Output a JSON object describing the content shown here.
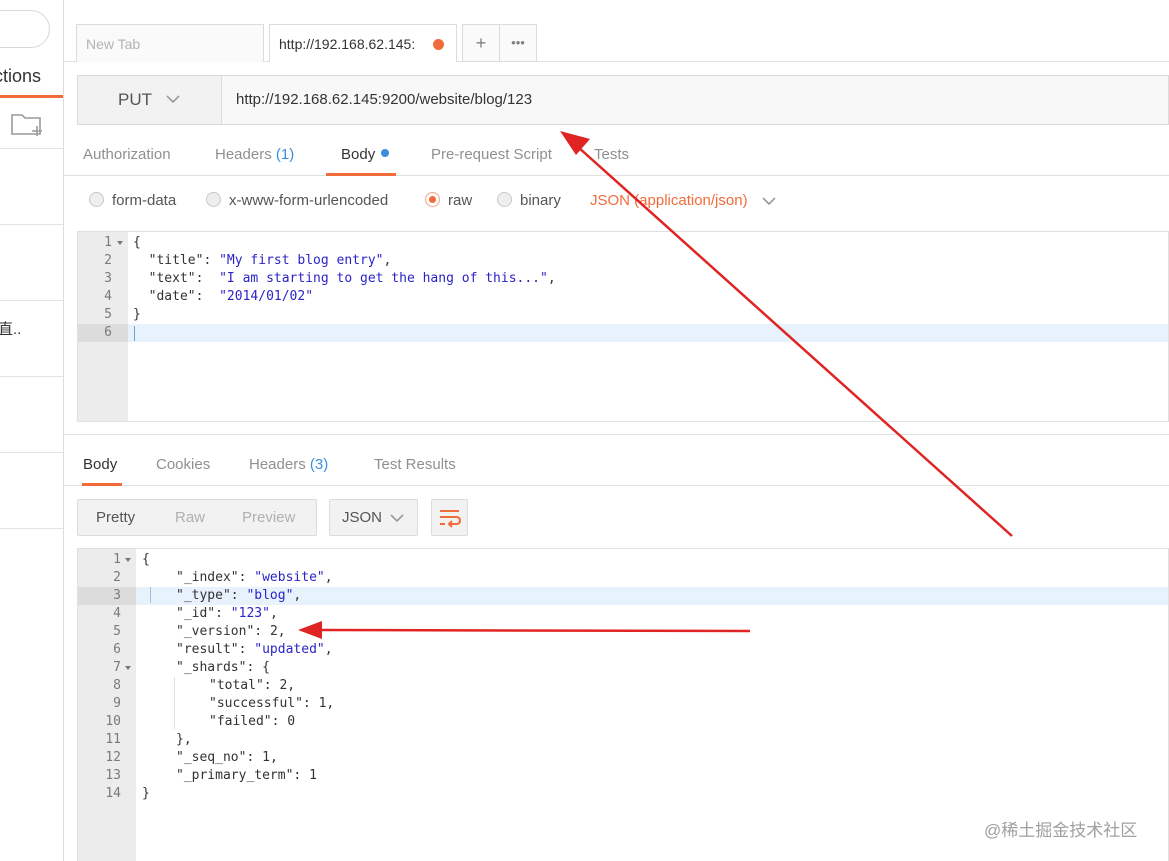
{
  "sidebar": {
    "title": "ctions",
    "item_text": "直.."
  },
  "tabs": {
    "new_tab_label": "New Tab",
    "active_tab_label": "http://192.168.62.145:",
    "add_label": "+",
    "more_label": "•••"
  },
  "request": {
    "method": "PUT",
    "url": "http://192.168.62.145:9200/website/blog/123",
    "tabs": {
      "authorization": "Authorization",
      "headers": "Headers",
      "headers_count": "(1)",
      "body": "Body",
      "pre_request": "Pre-request Script",
      "tests": "Tests"
    },
    "body_types": {
      "form_data": "form-data",
      "urlencoded": "x-www-form-urlencoded",
      "raw": "raw",
      "binary": "binary",
      "content_type": "JSON (application/json)"
    },
    "body_lines": [
      "1",
      "2",
      "3",
      "4",
      "5",
      "6"
    ],
    "body_code": {
      "l1": "{",
      "l2_key": "  \"title\"",
      "l2_val": "\"My first blog entry\"",
      "l3_key": "  \"text\"",
      "l3_val": "\"I am starting to get the hang of this...\"",
      "l4_key": "  \"date\"",
      "l4_val": "\"2014/01/02\"",
      "l5": "}"
    }
  },
  "response": {
    "tabs": {
      "body": "Body",
      "cookies": "Cookies",
      "headers": "Headers",
      "headers_count": "(3)",
      "test_results": "Test Results"
    },
    "views": {
      "pretty": "Pretty",
      "raw": "Raw",
      "preview": "Preview"
    },
    "format": "JSON",
    "lines": [
      "1",
      "2",
      "3",
      "4",
      "5",
      "6",
      "7",
      "8",
      "9",
      "10",
      "11",
      "12",
      "13",
      "14"
    ],
    "code": {
      "open": "{",
      "index_key": "\"_index\"",
      "index_val": "\"website\"",
      "type_key": "\"_type\"",
      "type_val": "\"blog\"",
      "id_key": "\"_id\"",
      "id_val": "\"123\"",
      "version_key": "\"_version\"",
      "version_val": "2",
      "result_key": "\"result\"",
      "result_val": "\"updated\"",
      "shards_key": "\"_shards\"",
      "total_key": "\"total\"",
      "total_val": "2",
      "successful_key": "\"successful\"",
      "successful_val": "1",
      "failed_key": "\"failed\"",
      "failed_val": "0",
      "shards_close": "},",
      "seq_key": "\"_seq_no\"",
      "seq_val": "1",
      "term_key": "\"_primary_term\"",
      "term_val": "1",
      "close": "}"
    }
  },
  "watermark": "@稀土掘金技术社区",
  "colors": {
    "accent": "#f26b3a",
    "link_blue": "#3a8fdc",
    "string": "#2a24c8",
    "annotation_arrow": "#e02424"
  }
}
